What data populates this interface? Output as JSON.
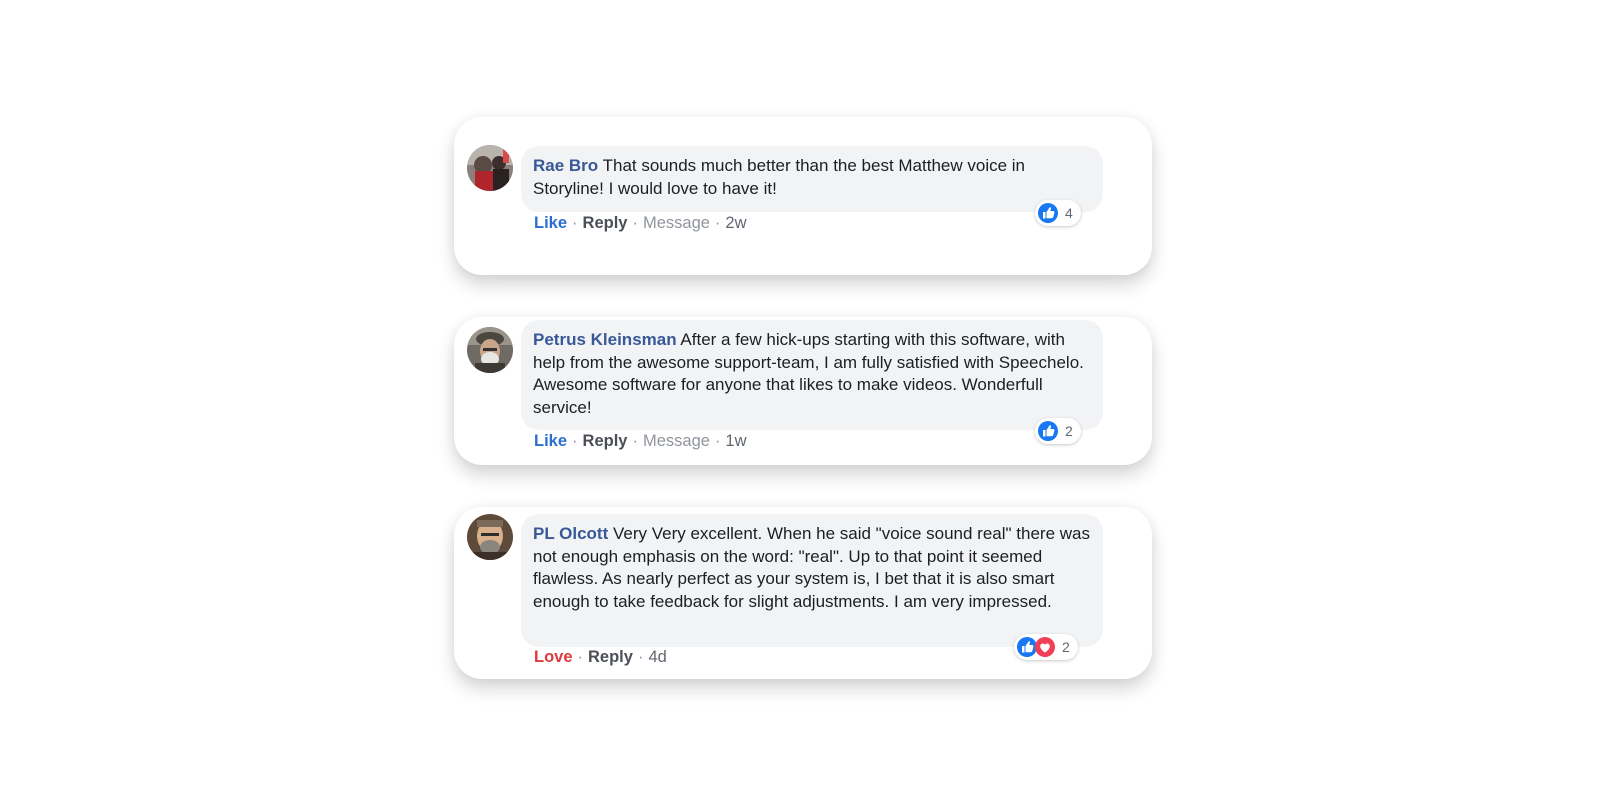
{
  "comments": [
    {
      "author": "Rae Bro",
      "text": "That sounds much better than the best Matthew voice in Storyline! I would love to have it!",
      "actions": {
        "primary": "Like",
        "reply": "Reply",
        "message": "Message",
        "time": "2w"
      },
      "reactions": {
        "icons": [
          "like-icon"
        ],
        "count": "4"
      }
    },
    {
      "author": "Petrus Kleinsman",
      "text": "After a few hick-ups starting with this software, with help from the awesome support-team, I am fully satisfied with Speechelo. Awesome software for anyone that likes to make videos. Wonderfull service!",
      "actions": {
        "primary": "Like",
        "reply": "Reply",
        "message": "Message",
        "time": "1w"
      },
      "reactions": {
        "icons": [
          "like-icon"
        ],
        "count": "2"
      }
    },
    {
      "author": "PL Olcott",
      "text": "Very Very excellent. When he said \"voice sound real\" there was not enough emphasis on the word: \"real\". Up to that point it seemed flawless. As nearly perfect as your system is, I bet that it is also smart enough to take feedback for slight adjustments. I am very impressed.",
      "actions": {
        "primary": "Love",
        "reply": "Reply",
        "time": "4d"
      },
      "reactions": {
        "icons": [
          "like-icon",
          "love-icon"
        ],
        "count": "2"
      }
    }
  ],
  "colors": {
    "author": "#385898",
    "like": "#2d6fd1",
    "love": "#e0393e",
    "bubble": "#f2f3f5"
  }
}
